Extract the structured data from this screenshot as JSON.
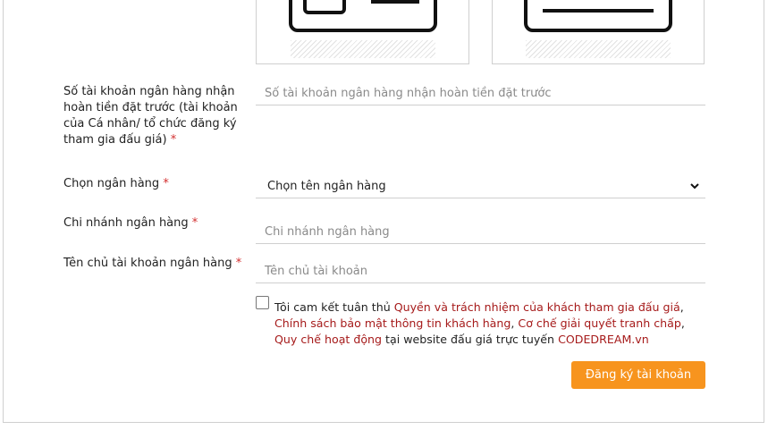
{
  "form": {
    "account_number": {
      "label": "Số tài khoản ngân hàng nhận hoàn tiền đặt trước (tài khoản của Cá nhân/ tổ chức đăng ký tham gia đấu giá)",
      "placeholder": "Số tài khoản ngân hàng nhận hoàn tiền đặt trước"
    },
    "bank": {
      "label": "Chọn ngân hàng",
      "selected": "Chọn tên ngân hàng"
    },
    "branch": {
      "label": "Chi nhánh ngân hàng",
      "placeholder": "Chi nhánh ngân hàng"
    },
    "holder": {
      "label": "Tên chủ tài khoản ngân hàng",
      "placeholder": "Tên chủ tài khoản"
    },
    "required_mark": "*"
  },
  "consent": {
    "prefix": "Tôi cam kết tuân thủ",
    "link1": "Quyền và trách nhiệm của khách tham gia đấu giá",
    "link2": "Chính sách bảo mật thông tin khách hàng",
    "link3": "Cơ chế giải quyết tranh chấp",
    "link4": "Quy chế hoạt động",
    "middle": "tại website đấu giá trực tuyến",
    "site": "CODEDREAM.vn"
  },
  "submit_label": "Đăng ký tài khoản",
  "colors": {
    "accent": "#f7941e",
    "link": "#a61b1b",
    "required": "#d32f2f"
  },
  "icons": {
    "card_front": "id-card-front-icon",
    "card_back": "id-card-back-icon",
    "dropdown": "chevron-down-icon"
  }
}
